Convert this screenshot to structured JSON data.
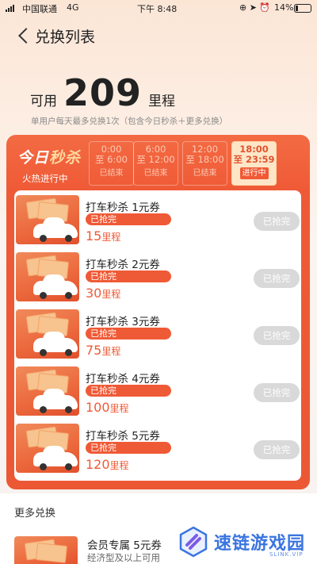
{
  "status_bar": {
    "carrier": "中国联通",
    "network": "4G",
    "time": "下午 8:48",
    "icons_text": "⊕ ➤ ⏰",
    "battery": "14%"
  },
  "nav": {
    "title": "兑换列表"
  },
  "balance": {
    "prefix": "可用",
    "value": "209",
    "unit": "里程",
    "rule": "单用户每天最多兑换1次（包含今日秒杀＋更多兑换）"
  },
  "flash_sale": {
    "title_a": "今日",
    "title_b": "秒杀",
    "subtitle": "火热进行中",
    "slots": [
      {
        "start": "0:00",
        "end": "至 6:00",
        "status": "已结束",
        "active": false
      },
      {
        "start": "6:00",
        "end": "至 12:00",
        "status": "已结束",
        "active": false
      },
      {
        "start": "12:00",
        "end": "至 18:00",
        "status": "已结束",
        "active": false
      },
      {
        "start": "18:00",
        "end": "至 23:59",
        "status": "进行中",
        "active": true
      }
    ],
    "items": [
      {
        "name": "打车秒杀 1元券",
        "sold_label": "已抢完",
        "cost": "15",
        "cost_unit": "里程",
        "button": "已抢完"
      },
      {
        "name": "打车秒杀 2元券",
        "sold_label": "已抢完",
        "cost": "30",
        "cost_unit": "里程",
        "button": "已抢完"
      },
      {
        "name": "打车秒杀 3元券",
        "sold_label": "已抢完",
        "cost": "75",
        "cost_unit": "里程",
        "button": "已抢完"
      },
      {
        "name": "打车秒杀 4元券",
        "sold_label": "已抢完",
        "cost": "100",
        "cost_unit": "里程",
        "button": "已抢完"
      },
      {
        "name": "打车秒杀 5元券",
        "sold_label": "已抢完",
        "cost": "120",
        "cost_unit": "里程",
        "button": "已抢完"
      }
    ]
  },
  "more": {
    "title": "更多兑换",
    "item": {
      "name": "会员专属 5元券",
      "desc": "经济型及以上可用"
    }
  },
  "watermark": {
    "text": "速链游戏园",
    "sub": "SLINK.VIP"
  },
  "colors": {
    "accent": "#ef5a36",
    "active_slot_bg": "#fde6c8",
    "disabled_button": "#d9d9d9"
  }
}
